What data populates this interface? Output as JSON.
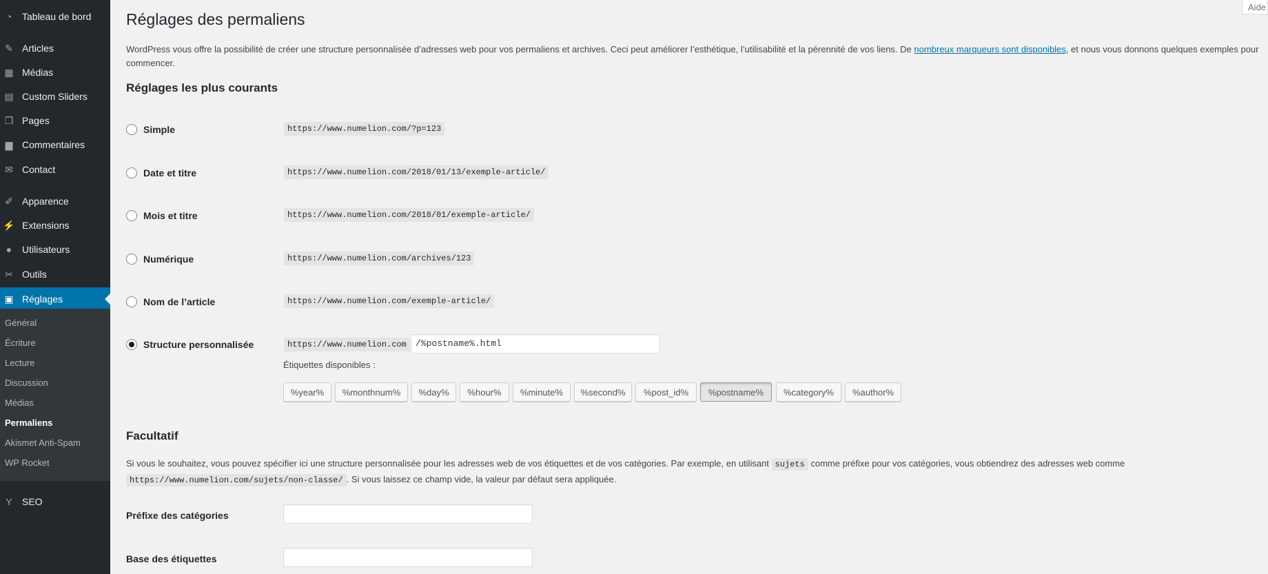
{
  "sidebar": {
    "menu": [
      {
        "label": "Tableau de bord",
        "icon": "dashboard-icon",
        "glyph": "◔"
      },
      {
        "label": "Articles",
        "icon": "pushpin-icon",
        "glyph": "✎"
      },
      {
        "label": "Médias",
        "icon": "media-icon",
        "glyph": "▦"
      },
      {
        "label": "Custom Sliders",
        "icon": "slides-icon",
        "glyph": "▤"
      },
      {
        "label": "Pages",
        "icon": "pages-icon",
        "glyph": "❐"
      },
      {
        "label": "Commentaires",
        "icon": "comment-icon",
        "glyph": "▆"
      },
      {
        "label": "Contact",
        "icon": "envelope-icon",
        "glyph": "✉"
      },
      {
        "label": "Apparence",
        "icon": "paintbrush-icon",
        "glyph": "✐"
      },
      {
        "label": "Extensions",
        "icon": "plugin-icon",
        "glyph": "⚡"
      },
      {
        "label": "Utilisateurs",
        "icon": "users-icon",
        "glyph": "●"
      },
      {
        "label": "Outils",
        "icon": "wrench-icon",
        "glyph": "✂"
      },
      {
        "label": "Réglages",
        "icon": "settings-icon",
        "glyph": "▣"
      },
      {
        "label": "SEO",
        "icon": "yoast-icon",
        "glyph": "Y"
      }
    ],
    "submenu": [
      "Général",
      "Écriture",
      "Lecture",
      "Discussion",
      "Médias",
      "Permaliens",
      "Akismet Anti-Spam",
      "WP Rocket"
    ]
  },
  "header": {
    "title": "Réglages des permaliens",
    "help": "Aide"
  },
  "intro": {
    "text_before": "WordPress vous offre la possibilité de créer une structure personnalisée d’adresses web pour vos permaliens et archives. Ceci peut améliorer l’esthétique, l’utilisabilité et la pérennité de vos liens. De ",
    "link": "nombreux marqueurs sont disponibles",
    "text_after": ", et nous vous donnons quelques exemples pour commencer."
  },
  "common": {
    "heading": "Réglages les plus courants",
    "options": [
      {
        "label": "Simple",
        "example": "https://www.numelion.com/?p=123"
      },
      {
        "label": "Date et titre",
        "example": "https://www.numelion.com/2018/01/13/exemple-article/"
      },
      {
        "label": "Mois et titre",
        "example": "https://www.numelion.com/2018/01/exemple-article/"
      },
      {
        "label": "Numérique",
        "example": "https://www.numelion.com/archives/123"
      },
      {
        "label": "Nom de l’article",
        "example": "https://www.numelion.com/exemple-article/"
      }
    ],
    "custom": {
      "label": "Structure personnalisée",
      "base": "https://www.numelion.com",
      "value": "/%postname%.html",
      "tags_label": "Étiquettes disponibles :",
      "tags": [
        "%year%",
        "%monthnum%",
        "%day%",
        "%hour%",
        "%minute%",
        "%second%",
        "%post_id%",
        "%postname%",
        "%category%",
        "%author%"
      ]
    }
  },
  "optional": {
    "heading": "Facultatif",
    "desc_1": "Si vous le souhaitez, vous pouvez spécifier ici une structure personnalisée pour les adresses web de vos étiquettes et de vos catégories. Par exemple, en utilisant ",
    "code_1": "sujets",
    "desc_2": " comme préfixe pour vos catégories, vous obtiendrez des adresses web comme ",
    "code_2": "https://www.numelion.com/sujets/non-classe/",
    "desc_3": ". Si vous laissez ce champ vide, la valeur par défaut sera appliquée.",
    "category_base_label": "Préfixe des catégories",
    "category_base_value": "",
    "tag_base_label": "Base des étiquettes",
    "tag_base_value": ""
  }
}
